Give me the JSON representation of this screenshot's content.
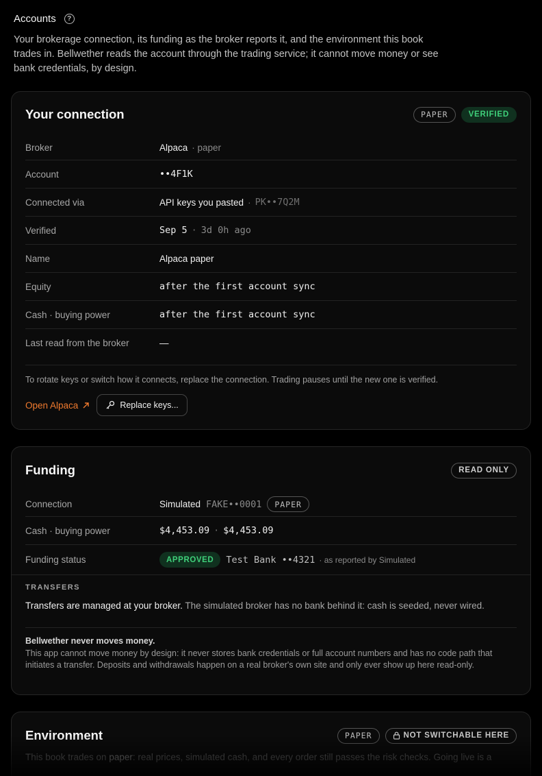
{
  "header": {
    "title": "Accounts",
    "help_icon": "?",
    "intro": "Your brokerage connection, its funding as the broker reports it, and the environment this book trades in. Bellwether reads the account through the trading service; it cannot move money or see bank credentials, by design."
  },
  "connection": {
    "title": "Your connection",
    "badge_env": "PAPER",
    "badge_status": "VERIFIED",
    "rows": {
      "broker": {
        "label": "Broker",
        "value": "Alpaca",
        "suffix": "· paper"
      },
      "account": {
        "label": "Account",
        "value": "••4F1K"
      },
      "connected_via": {
        "label": "Connected via",
        "value": "API keys you pasted",
        "sep": "·",
        "key": "PK••7Q2M"
      },
      "verified": {
        "label": "Verified",
        "date": "Sep 5",
        "sep": "·",
        "ago": "3d 0h ago"
      },
      "name": {
        "label": "Name",
        "value": "Alpaca paper"
      },
      "equity": {
        "label": "Equity",
        "value": "after the first account sync"
      },
      "cash": {
        "label": "Cash · buying power",
        "value": "after the first account sync"
      },
      "last_read": {
        "label": "Last read from the broker",
        "value": "—"
      }
    },
    "note": "To rotate keys or switch how it connects, replace the connection. Trading pauses until the new one is verified.",
    "open_link": "Open Alpaca",
    "replace_button": "Replace keys..."
  },
  "funding": {
    "title": "Funding",
    "badge": "READ ONLY",
    "rows": {
      "connection": {
        "label": "Connection",
        "value": "Simulated",
        "account": "FAKE••0001",
        "badge": "PAPER"
      },
      "cash": {
        "label": "Cash · buying power",
        "cash": "$4,453.09",
        "sep": "·",
        "buying_power": "$4,453.09"
      },
      "status": {
        "label": "Funding status",
        "badge": "APPROVED",
        "bank": "Test Bank ••4321",
        "source": "· as reported by Simulated"
      }
    },
    "transfers_label": "TRANSFERS",
    "transfers_strong": "Transfers are managed at your broker.",
    "transfers_rest": " The simulated broker has no bank behind it: cash is seeded, never wired.",
    "never_title": "Bellwether never moves money.",
    "never_body": "This app cannot move money by design: it never stores bank credentials or full account numbers and has no code path that initiates a transfer. Deposits and withdrawals happen on a real broker's own site and only ever show up here read-only."
  },
  "environment": {
    "title": "Environment",
    "badge_env": "PAPER",
    "badge_lock": "NOT SWITCHABLE HERE",
    "body_pre": "This book trades on ",
    "body_strong": "paper",
    "body_post": ": real prices, simulated cash, and every order still passes the risk checks. Going live is a"
  }
}
